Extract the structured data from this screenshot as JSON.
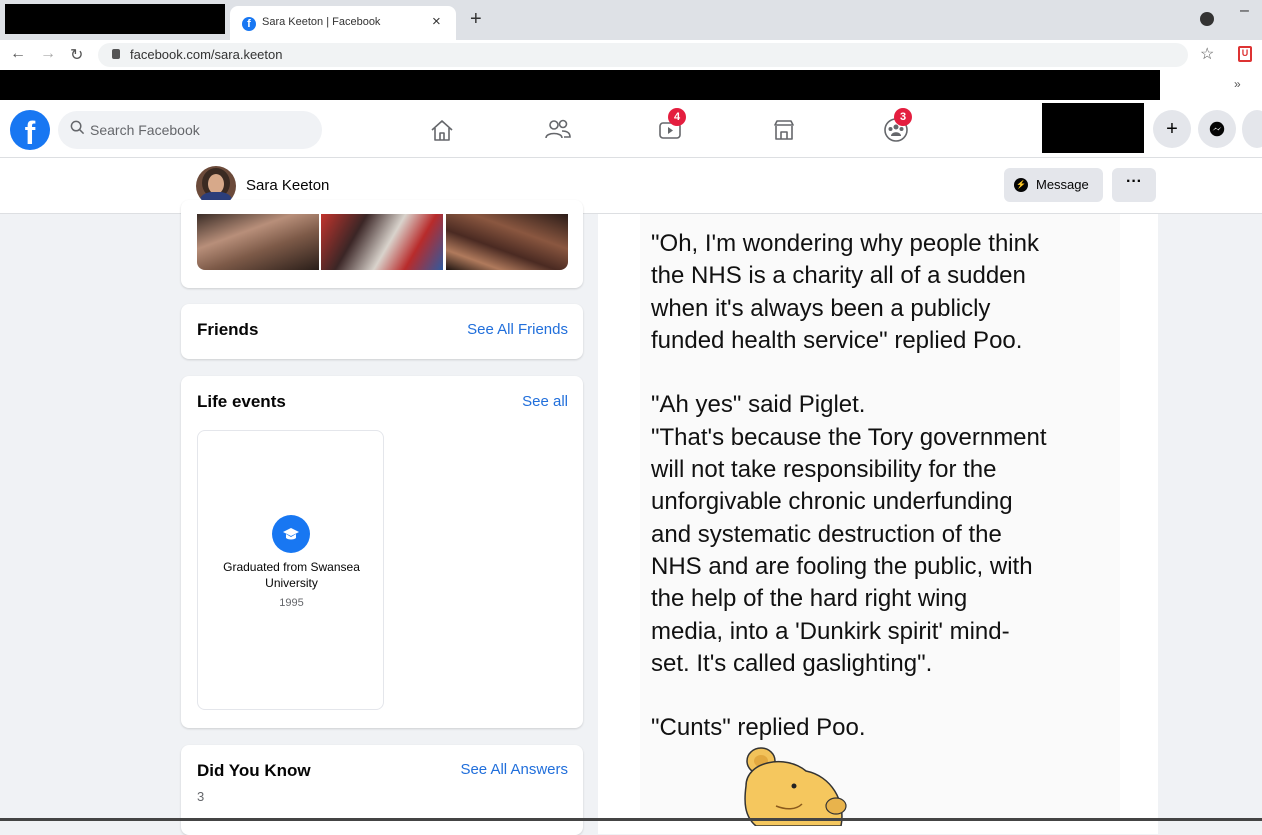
{
  "browser": {
    "tab_title": "Sara Keeton | Facebook",
    "tab_close": "×",
    "new_tab": "+",
    "url": "facebook.com/sara.keeton",
    "bookmarks_more": "»"
  },
  "facebook": {
    "search_placeholder": "Search Facebook",
    "badges": {
      "watch": "4",
      "groups": "3"
    },
    "brand_color": "#1877f2"
  },
  "profile": {
    "name": "Sara Keeton",
    "message_label": "Message",
    "more_label": "···"
  },
  "left": {
    "friends_title": "Friends",
    "friends_link": "See All Friends",
    "life_title": "Life events",
    "life_link": "See all",
    "life_event_title": "Graduated from Swansea University",
    "life_event_year": "1995",
    "dyk_title": "Did You Know",
    "dyk_link": "See All Answers",
    "dyk_count": "3"
  },
  "post": {
    "text": "\"Oh, I'm wondering why people think\nthe NHS is a charity all of a sudden\nwhen it's always been a publicly\nfunded health service\" replied Poo.\n\n\"Ah yes\" said Piglet.\n\"That's because the Tory government\nwill not take responsibility for the\nunforgivable chronic underfunding\nand systematic destruction of the\nNHS and are fooling the public, with\nthe help of the hard right wing\nmedia, into a 'Dunkirk spirit' mind-\nset. It's called gaslighting\".\n\n\"Cunts\" replied Poo."
  }
}
